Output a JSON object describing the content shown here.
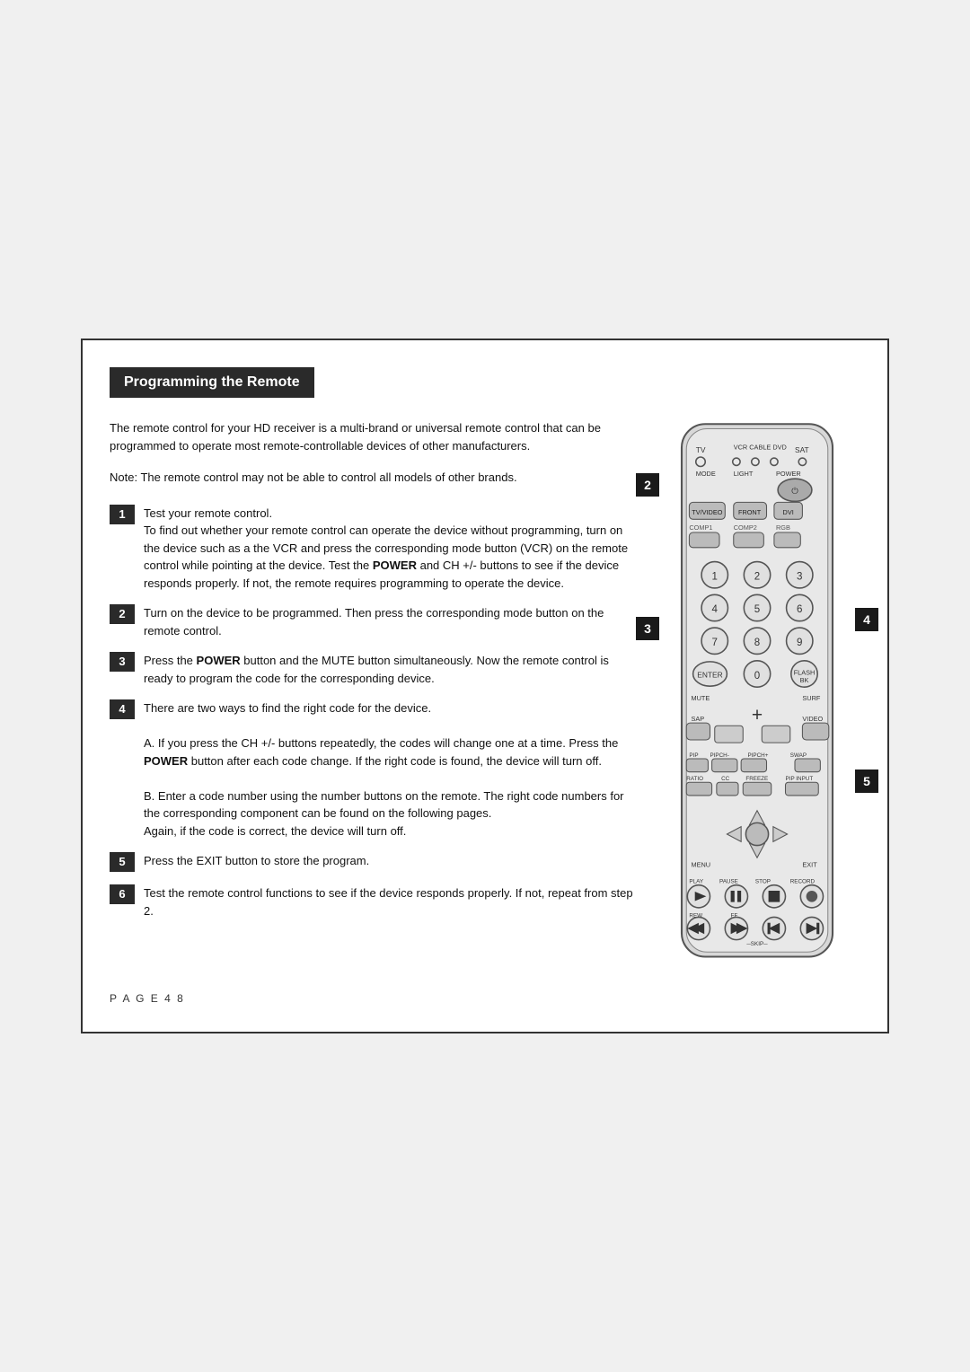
{
  "header": {
    "title": "Programming the Remote"
  },
  "intro": {
    "paragraph1": "The remote control for your HD receiver is a multi-brand or universal remote control that can be programmed to operate most remote-controllable devices of other manufacturers.",
    "paragraph2": "Note: The remote control may not be able to control all models of other brands."
  },
  "steps": [
    {
      "number": "1",
      "text": "Test your remote control.\nTo find out whether your remote control can operate the device without programming, turn on the device such as a the VCR and press the corresponding mode button (VCR) on the remote control while pointing at the device. Test the POWER and CH +/- buttons to see if the device responds properly. If not, the remote requires programming to operate the device."
    },
    {
      "number": "2",
      "text": "Turn on the device to be programmed. Then press the corresponding mode button on the remote control."
    },
    {
      "number": "3",
      "text": "Press the POWER button and the MUTE button simultaneously. Now the remote control is ready to program the code for the corresponding device."
    },
    {
      "number": "4",
      "text": "There are two ways to find the right code for the device.\n\nA. If you press the CH +/- buttons repeatedly, the codes will change one at a time. Press the POWER button after each code change. If the right code is found, the device will turn off.\n\nB. Enter a code number using the number buttons on the remote. The right code numbers for the corresponding component can be found on the following pages.\nAgain, if the code is correct, the device will turn off."
    },
    {
      "number": "5",
      "text": "Press the EXIT button to store the program."
    },
    {
      "number": "6",
      "text": "Test the remote control functions to see if the device responds properly. If not, repeat from step 2."
    }
  ],
  "callouts": [
    "2",
    "3",
    "4",
    "5"
  ],
  "footer": {
    "text": "P A G E   4 8"
  }
}
